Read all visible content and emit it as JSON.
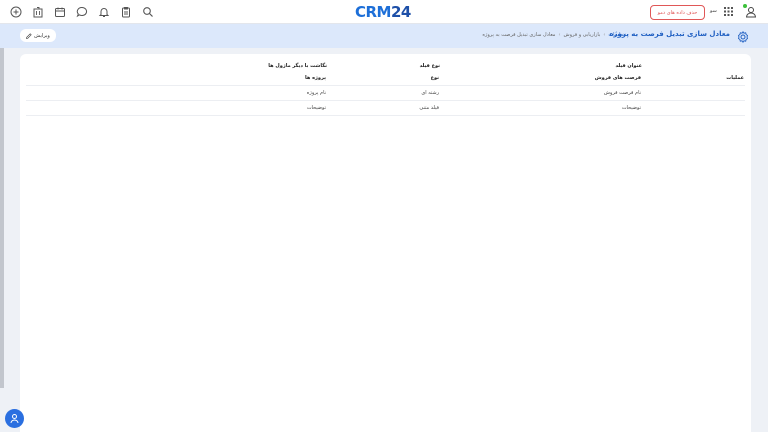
{
  "topbar": {
    "logo_main": "CRM",
    "logo_num": "24",
    "demo_button": "حذف داده های دمو",
    "user_name": "سو",
    "icons": [
      "add-circle-icon",
      "building-icon",
      "calendar-icon",
      "chat-icon",
      "bell-icon",
      "clipboard-icon",
      "search-icon"
    ]
  },
  "header": {
    "title": "معادل سازی تبدیل فرصت به پروژه",
    "breadcrumb": [
      "تنظیمات",
      "بازاریابی و فروش",
      "معادل سازی تبدیل فرصت به پروژه"
    ],
    "edit_button": "ویرایش"
  },
  "table": {
    "operations_label": "عملیات",
    "headers": {
      "field_title": "عنوان فیلد",
      "field_type": "نوع فیلد",
      "mapping": "نگاشت با دیگر ماژول ها"
    },
    "subheaders": {
      "module": "فرصت های فروش",
      "type": "نوع",
      "target": "پروژه ها"
    },
    "rows": [
      {
        "source": "نام فرصت فروش",
        "type": "رشته ای",
        "target": "نام پروژه"
      },
      {
        "source": "توضیحات",
        "type": "فیلد متنی",
        "target": "توضیحات"
      }
    ]
  },
  "colors": {
    "accent": "#1f5fc2",
    "header_band": "#dce8fb",
    "demo_red": "#e05757",
    "online": "#3cc13b"
  }
}
